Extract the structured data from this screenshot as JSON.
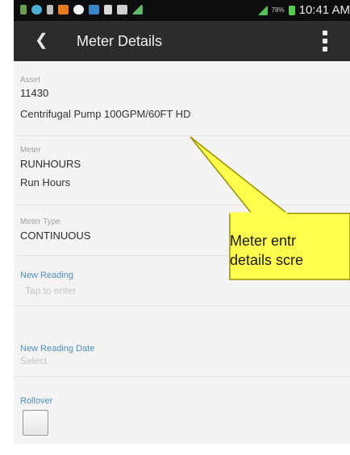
{
  "status_bar": {
    "time": "10:41 AM",
    "battery_percent": "78%",
    "icons": [
      "usb-icon",
      "notification-icon",
      "menu-icon",
      "app-orange-icon",
      "cloud-icon",
      "app-blue-icon",
      "document-icon",
      "mail-icon",
      "wifi-icon",
      "signal-icon",
      "battery-icon"
    ]
  },
  "app_bar": {
    "back_icon": "chevron-left-icon",
    "title": "Meter Details",
    "menu_icon": "overflow-menu-icon"
  },
  "fields": {
    "asset": {
      "label": "Asset",
      "value": "11430",
      "description": "Centrifugal Pump 100GPM/60FT HD"
    },
    "meter": {
      "label": "Meter",
      "value": "RUNHOURS",
      "description": "Run Hours"
    },
    "meter_type": {
      "label": "Meter Type",
      "value": "CONTINUOUS"
    },
    "new_reading": {
      "label": "New Reading",
      "placeholder": "Tap to enter"
    },
    "new_reading_date": {
      "label": "New Reading Date",
      "placeholder": "Select"
    },
    "rollover": {
      "label": "Rollover",
      "checked": false
    }
  },
  "callout": {
    "line1": "Meter entr",
    "line2": "details scre",
    "fill_color": "#ffff4d",
    "border_color": "#9a8f00"
  },
  "colors": {
    "app_bar": "#2c2c2c",
    "status_bar": "#0d0d0d",
    "accent_label": "#4f8fb8"
  }
}
